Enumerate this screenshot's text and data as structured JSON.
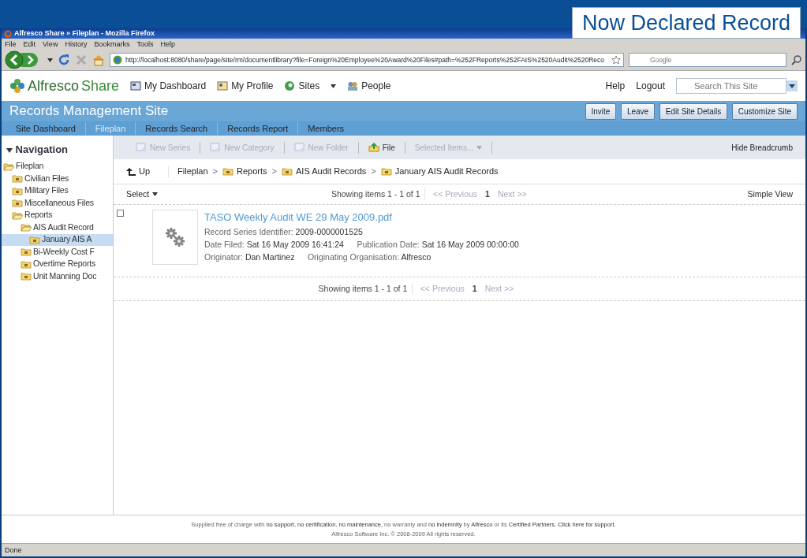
{
  "banner": {
    "title": "Now Declared Record"
  },
  "window": {
    "title": "Alfresco Share » Fileplan - Mozilla Firefox"
  },
  "menu": [
    "File",
    "Edit",
    "View",
    "History",
    "Bookmarks",
    "Tools",
    "Help"
  ],
  "address": {
    "url": "http://localhost:8080/share/page/site/rm/documentlibrary?file=Foreign%20Employee%20Award%20Files#path=%252FReports%252FAIS%2520Audit%2520Reco"
  },
  "web_search": {
    "placeholder": "Google"
  },
  "app_header": {
    "logo_first": "Alfresco",
    "logo_second": "Share",
    "links": [
      {
        "label": "My Dashboard",
        "kind": "dashboard"
      },
      {
        "label": "My Profile",
        "kind": "profile"
      },
      {
        "label": "Sites",
        "kind": "sites"
      },
      {
        "label": "People",
        "kind": "people"
      }
    ],
    "right_links": [
      "Help",
      "Logout"
    ],
    "search": {
      "placeholder": "Search This Site"
    }
  },
  "site": {
    "title": "Records Management Site",
    "buttons": [
      "Invite",
      "Leave",
      "Edit Site Details",
      "Customize Site"
    ]
  },
  "site_nav": [
    {
      "label": "Site Dashboard",
      "selected": false
    },
    {
      "label": "Fileplan",
      "selected": true
    },
    {
      "label": "Records Search",
      "selected": false
    },
    {
      "label": "Records Report",
      "selected": false
    },
    {
      "label": "Members",
      "selected": false
    }
  ],
  "navigation": {
    "title": "Navigation",
    "tree": [
      {
        "label": "Fileplan",
        "expanded": true,
        "selected": false,
        "children": [
          {
            "label": "Civilian Files",
            "expanded": false,
            "selected": false
          },
          {
            "label": "Military Files",
            "expanded": false,
            "selected": false
          },
          {
            "label": "Miscellaneous Files",
            "expanded": false,
            "selected": false
          },
          {
            "label": "Reports",
            "expanded": true,
            "selected": false,
            "children": [
              {
                "label": "AIS Audit Record",
                "expanded": true,
                "selected": false,
                "children": [
                  {
                    "label": "January AIS A",
                    "expanded": false,
                    "selected": true
                  }
                ]
              },
              {
                "label": "Bi-Weekly Cost F",
                "expanded": false,
                "selected": false
              },
              {
                "label": "Overtime Reports",
                "expanded": false,
                "selected": false
              },
              {
                "label": "Unit Manning Doc",
                "expanded": false,
                "selected": false
              }
            ]
          }
        ]
      }
    ]
  },
  "toolbar": {
    "actions": [
      {
        "label": "New Series",
        "kind": "new",
        "disabled": true
      },
      {
        "label": "New Category",
        "kind": "new",
        "disabled": true
      },
      {
        "label": "New Folder",
        "kind": "new",
        "disabled": true
      },
      {
        "label": "File",
        "kind": "file",
        "disabled": false
      },
      {
        "label": "Selected Items...",
        "kind": "menu",
        "disabled": true
      }
    ],
    "hide_breadcrumb": "Hide Breadcrumb"
  },
  "breadcrumb": {
    "up": "Up",
    "root": "Fileplan",
    "separator": ">",
    "folders": [
      "Reports",
      "AIS Audit Records",
      "January AIS Audit Records"
    ]
  },
  "list": {
    "select": "Select",
    "view": "Simple View",
    "paging_top": {
      "showing": "Showing items 1 - 1 of 1",
      "previous": "<< Previous",
      "page": "1",
      "next": "Next >>"
    },
    "items": [
      {
        "name": "TASO Weekly Audit WE 29 May 2009.pdf",
        "selected": false,
        "rows": [
          [
            {
              "label": "Record Series Identifier:",
              "value": "2009-0000001525"
            }
          ],
          [
            {
              "label": "Date Filed:",
              "value": "Sat 16 May 2009 16:41:24"
            },
            {
              "label": "Publication Date:",
              "value": "Sat 16 May 2009 00:00:00"
            }
          ],
          [
            {
              "label": "Originator:",
              "value": "Dan Martinez"
            },
            {
              "label": "Originating Organisation:",
              "value": "Alfresco"
            }
          ]
        ]
      }
    ],
    "paging_bottom": {
      "showing": "Showing items 1 - 1 of 1",
      "previous": "<< Previous",
      "page": "1",
      "next": "Next >>"
    }
  },
  "footer": {
    "notice": "Supplied free of charge with **no support**, **no certification**, **no maintenance**, no warranty and **no indemnity** by **Alfresco** or its **Certified Partners**. **Click here for support**.",
    "copyright": "Alfresco Software Inc. © 2008-2009 All rights reserved."
  },
  "status_bar": {
    "text": "Done"
  }
}
